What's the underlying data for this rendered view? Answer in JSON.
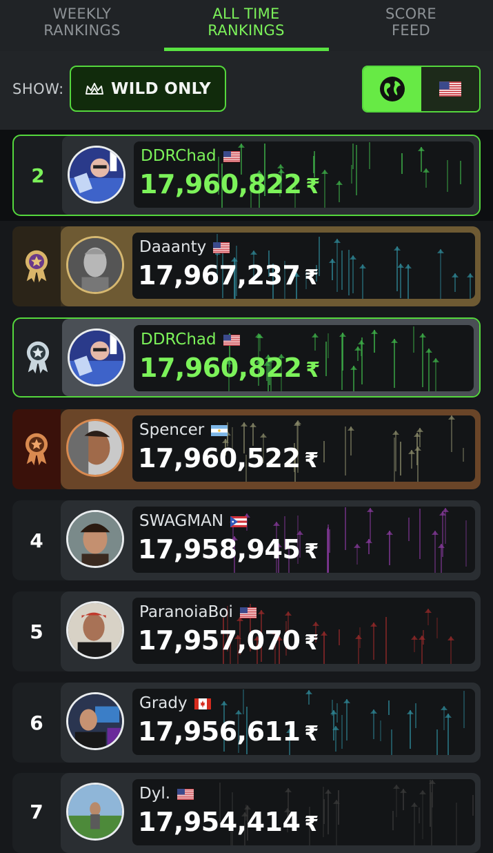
{
  "tabs": [
    {
      "line1": "WEEKLY",
      "line2": "RANKINGS"
    },
    {
      "line1": "ALL TIME",
      "line2": "RANKINGS"
    },
    {
      "line1": "SCORE",
      "line2": "FEED"
    }
  ],
  "filter": {
    "show_label": "SHOW:",
    "wild_label": "WILD ONLY"
  },
  "region_toggle": {
    "options": [
      "globe-icon",
      "us-flag-icon"
    ],
    "selected": "globe-icon"
  },
  "currency_symbol": "₹",
  "colors": {
    "accent": "#59e342",
    "gold": "#d6b871",
    "silver": "#c9d6dd",
    "bronze": "#d98a50"
  },
  "pinned_row": {
    "rank": "2",
    "name": "DDRChad",
    "flag": "us",
    "score": "17,960,822"
  },
  "rows": [
    {
      "rank_badge": "gold-medal-icon",
      "name": "Daaanty",
      "flag": "us",
      "score": "17,967,237"
    },
    {
      "rank_badge": "silver-medal-icon",
      "name": "DDRChad",
      "flag": "us",
      "score": "17,960,822"
    },
    {
      "rank_badge": "bronze-medal-icon",
      "name": "Spencer",
      "flag": "ar",
      "score": "17,960,522"
    },
    {
      "rank": "4",
      "name": "SWAGMAN",
      "flag": "pr",
      "score": "17,958,945"
    },
    {
      "rank": "5",
      "name": "ParanoiaBoi",
      "flag": "us",
      "score": "17,957,070"
    },
    {
      "rank": "6",
      "name": "Grady",
      "flag": "ca",
      "score": "17,956,611"
    },
    {
      "rank": "7",
      "name": "Dyl.",
      "flag": "us",
      "score": "17,954,414"
    }
  ]
}
